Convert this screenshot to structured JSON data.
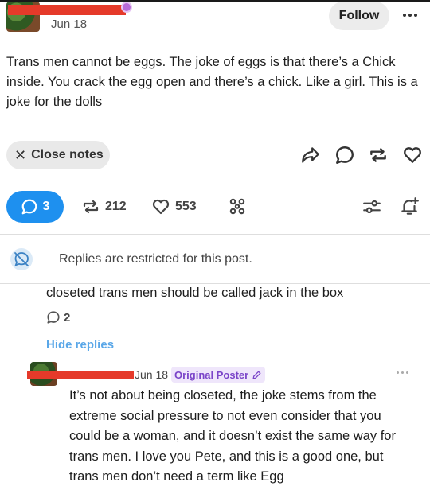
{
  "post": {
    "date": "Jun 18",
    "follow_label": "Follow",
    "body": "Trans men cannot be eggs. The joke of eggs is that there’s a Chick inside. You crack the egg open and there’s a chick. Like a girl. This is a joke for the dolls"
  },
  "actions": {
    "close_notes_label": "Close notes",
    "icons": [
      "share-icon",
      "comment-icon",
      "reblog-icon",
      "like-icon"
    ]
  },
  "stats": {
    "replies": "3",
    "reblogs": "212",
    "likes": "553"
  },
  "restricted_notice": "Replies are restricted for this post.",
  "replies": [
    {
      "text": "closeted trans men should be called jack in the box",
      "reply_count": "2",
      "hide_label": "Hide replies"
    },
    {
      "date": "Jun 18",
      "badge": "Original Poster",
      "text": "It’s not about being closeted, the joke stems from the extreme social pressure to not even consider that you could be a woman, and it doesn’t exist the same way for trans men. I love you Pete, and this is a good one, but trans men don’t need a term like Egg"
    }
  ],
  "colors": {
    "accent_blue": "#1e90ef",
    "redaction": "#e53a2a",
    "op_badge_text": "#7b45c9",
    "op_badge_bg": "#efe6fb",
    "hide_replies": "#5aa7e8"
  }
}
